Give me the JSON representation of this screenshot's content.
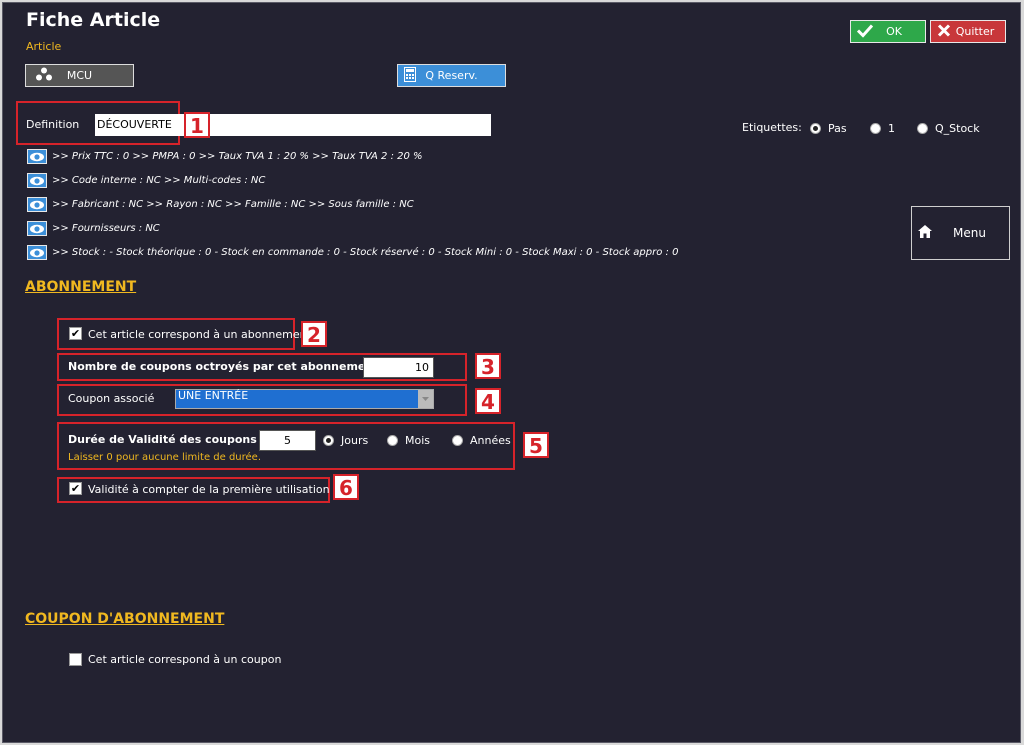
{
  "header": {
    "title": "Fiche Article",
    "subtitle": "Article"
  },
  "toolbar": {
    "ok_label": "OK",
    "quit_label": "Quitter",
    "mcu_label": "MCU",
    "qreserv_label": "Q Reserv.",
    "menu_label": "Menu"
  },
  "definition": {
    "label": "Definition",
    "value": "DÉCOUVERTE"
  },
  "etiquettes": {
    "label": "Etiquettes:",
    "options": [
      "Pas",
      "1",
      "Q_Stock"
    ],
    "selected": "Pas"
  },
  "info_lines": [
    ">> Prix TTC : 0 >> PMPA : 0 >> Taux TVA 1 : 20 % >> Taux TVA 2 : 20 %",
    ">> Code interne : NC >> Multi-codes : NC",
    ">> Fabricant : NC >> Rayon : NC >> Famille : NC >> Sous famille : NC",
    ">> Fournisseurs : NC",
    ">> Stock : - Stock théorique : 0 - Stock en commande : 0 - Stock réservé : 0 - Stock Mini : 0 - Stock Maxi : 0 - Stock appro : 0"
  ],
  "abonnement": {
    "section_title": "ABONNEMENT",
    "is_subscription_label": "Cet article correspond à un abonnement",
    "is_subscription_checked": true,
    "coupons_label": "Nombre de coupons octroyés par cet abonnement",
    "coupons_value": "10",
    "coupon_assoc_label": "Coupon associé",
    "coupon_assoc_value": "UNE ENTRÉE",
    "validity_label": "Durée de Validité des coupons",
    "validity_value": "5",
    "validity_units": [
      "Jours",
      "Mois",
      "Années"
    ],
    "validity_unit_selected": "Jours",
    "validity_hint": "Laisser 0 pour aucune limite de durée.",
    "first_use_label": "Validité à compter de la première utilisation",
    "first_use_checked": true
  },
  "coupon_section": {
    "section_title": "COUPON D'ABONNEMENT",
    "is_coupon_label": "Cet article correspond à un coupon",
    "is_coupon_checked": false
  },
  "callouts": [
    "1",
    "2",
    "3",
    "4",
    "5",
    "6"
  ],
  "colors": {
    "background": "#232231",
    "accent": "#f0b820",
    "ok": "#2ea84a",
    "quit": "#c8373a",
    "blue": "#3c8fd8",
    "callout": "#d6232a"
  },
  "icons": {
    "ok": "checkmark-icon",
    "quit": "close-icon",
    "mcu": "dots-icon",
    "qreserv": "calculator-icon",
    "menu": "home-icon",
    "info": "eye-icon"
  }
}
